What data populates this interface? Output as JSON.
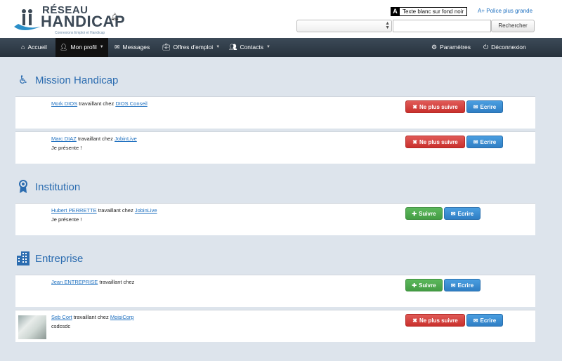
{
  "header": {
    "logo_line1": "RÉSEAU",
    "logo_line2": "HANDICAP",
    "logo_tagline": "Connexions Emploi et Handicap",
    "contrast_key": "A",
    "contrast_label": "Texte blanc sur fond noir",
    "bigger_font_label": "A+ Police plus grande",
    "search_select_value": "",
    "search_value": "",
    "search_button": "Rechercher"
  },
  "nav": {
    "accueil": "Accueil",
    "mon_profil": "Mon profil",
    "messages": "Messages",
    "offres": "Offres d'emploi",
    "contacts": "Contacts",
    "parametres": "Paramètres",
    "deconnexion": "Déconnexion"
  },
  "labels": {
    "working_at": "travaillant chez",
    "unfollow": "Ne plus suivre",
    "follow": "Suivre",
    "write": "Ecrire"
  },
  "sections": [
    {
      "title": "Mission Handicap",
      "icon": "wheelchair-icon",
      "contacts": [
        {
          "name": "Mork DIOS",
          "company": "DIOS Conseil",
          "note": "",
          "following": true
        },
        {
          "name": "Marc DIAZ",
          "company": "JobinLive",
          "note": "Je présente !",
          "following": true
        }
      ]
    },
    {
      "title": "Institution",
      "icon": "award-icon",
      "contacts": [
        {
          "name": "Hubert PERRETTE",
          "company": "JobinLive",
          "note": "Je présente !",
          "following": false
        }
      ]
    },
    {
      "title": "Entreprise",
      "icon": "building-icon",
      "contacts": [
        {
          "name": "Jean ENTREPRISE",
          "company": "",
          "note": "",
          "following": false
        },
        {
          "name": "Seb Cort",
          "company": "MoisiCorp",
          "note": "csdcsdc",
          "following": true
        }
      ]
    }
  ],
  "colors": {
    "navbar": "#2e3a46",
    "accent": "#2b6cb0",
    "danger": "#d9534f",
    "success": "#5cb85c",
    "primary": "#428bca",
    "page_bg": "#dde4ec"
  }
}
